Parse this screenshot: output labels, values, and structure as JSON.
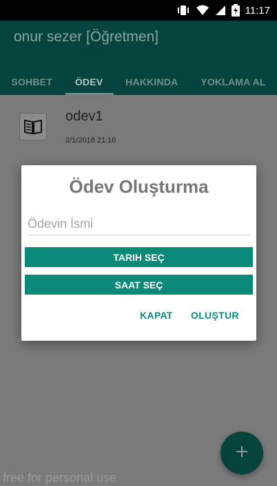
{
  "status_bar": {
    "time": "11:17",
    "icons": [
      "vibrate-icon",
      "wifi-icon",
      "signal-icon",
      "battery-charging-icon"
    ]
  },
  "app_bar": {
    "title": "onur sezer [Öğretmen]",
    "tabs": [
      {
        "label": "SOHBET",
        "active": false
      },
      {
        "label": "ÖDEV",
        "active": true
      },
      {
        "label": "HAKKINDA",
        "active": false
      },
      {
        "label": "YOKLAMA AL",
        "active": false
      }
    ]
  },
  "list": {
    "items": [
      {
        "icon": "book-icon",
        "title": "odev1",
        "date": "2/1/2018  21:16"
      }
    ]
  },
  "dialog": {
    "title": "Ödev Oluşturma",
    "input": {
      "placeholder": "Ödevin İsmi",
      "value": ""
    },
    "date_button": "TARIH SEÇ",
    "time_button": "SAAT SEÇ",
    "close_button": "KAPAT",
    "create_button": "OLUŞTUR"
  },
  "fab": {
    "icon": "plus-icon"
  },
  "watermark": "free for personal use",
  "colors": {
    "primary": "#0b8a7a",
    "primary_dark": "#06433c",
    "status_bar": "#000000"
  }
}
